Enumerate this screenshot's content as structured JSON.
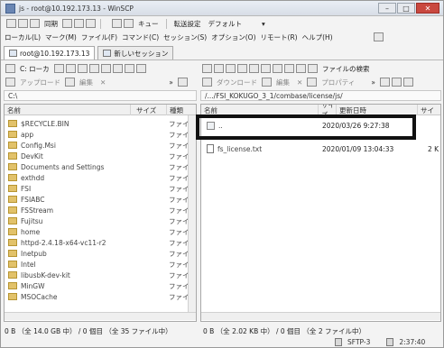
{
  "window": {
    "title": "js - root@10.192.173.13 - WinSCP",
    "controls": {
      "min": "–",
      "max": "□",
      "close": "✕"
    }
  },
  "toolbar": {
    "sync_label": "同期",
    "queue_label": "キュー",
    "transfer_settings_label": "転送設定",
    "transfer_settings_value": "デフォルト"
  },
  "menubar": {
    "items": [
      "ローカル(L)",
      "マーク(M)",
      "ファイル(F)",
      "コマンド(C)",
      "セッション(S)",
      "オプション(O)",
      "リモート(R)",
      "ヘルプ(H)"
    ]
  },
  "tabs": [
    {
      "label": "root@10.192.173.13"
    },
    {
      "label": "新しいセッション"
    }
  ],
  "local": {
    "drive_label": "C: ローカ",
    "upload_label": "アップロード",
    "edit_label": "編集",
    "path": "C:\\",
    "columns": [
      "名前",
      "サイズ",
      "種類"
    ],
    "files": [
      {
        "name": "$RECYCLE.BIN",
        "type": "ファイ"
      },
      {
        "name": "app",
        "type": "ファイ"
      },
      {
        "name": "Config.Msi",
        "type": "ファイ"
      },
      {
        "name": "DevKit",
        "type": "ファイ"
      },
      {
        "name": "Documents and Settings",
        "type": "ファイ"
      },
      {
        "name": "exthdd",
        "type": "ファイ"
      },
      {
        "name": "FSI",
        "type": "ファイ"
      },
      {
        "name": "FSIABC",
        "type": "ファイ"
      },
      {
        "name": "FSStream",
        "type": "ファイ"
      },
      {
        "name": "Fujitsu",
        "type": "ファイ"
      },
      {
        "name": "home",
        "type": "ファイ"
      },
      {
        "name": "httpd-2.4.18-x64-vc11-r2",
        "type": "ファイ"
      },
      {
        "name": "Inetpub",
        "type": "ファイ"
      },
      {
        "name": "Intel",
        "type": "ファイ"
      },
      {
        "name": "libusbK-dev-kit",
        "type": "ファイ"
      },
      {
        "name": "MinGW",
        "type": "ファイ"
      },
      {
        "name": "MSOCache",
        "type": "ファイ"
      }
    ],
    "status": "0 B （全 14.0 GB 中） / 0 個目 （全 35 ファイル中）"
  },
  "remote": {
    "download_label": "ダウンロード",
    "edit_label": "編集",
    "properties_label": "プロパティ",
    "path": "/.../FSI_KOKUGO_3_1/combase/license/js/",
    "columns": [
      "名前",
      "サイズ",
      "更新日時",
      "サイ"
    ],
    "files": [
      {
        "name": "..",
        "size": "",
        "date": "2020/03/26 9:27:38",
        "trail": ""
      },
      {
        "name": "fs_license.txt",
        "size": "",
        "date": "2020/01/09 13:04:33",
        "trail": "2 K"
      }
    ],
    "status": "0 B （全 2.02 KB 中） / 0 個目 （全 2 ファイル中）"
  },
  "statusbar": {
    "protocol": "SFTP-3",
    "time": "2:37:40"
  },
  "search_label": "ファイルの検索"
}
